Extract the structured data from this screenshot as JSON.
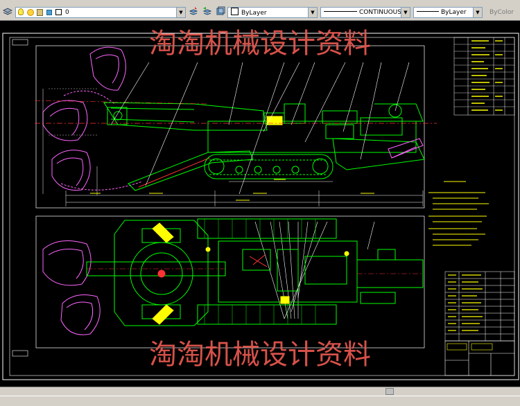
{
  "toolbar": {
    "layer_name": "0",
    "color_value": "ByLayer",
    "linetype_value": "CONTINUOUS",
    "lineweight_value": "ByLayer",
    "plotstyle_value": "ByColor"
  },
  "watermark": {
    "text_top": "淘淘机械设计资料",
    "text_bottom": "淘淘机械设计资料",
    "color": "#e8584f"
  },
  "colors": {
    "frame": "#ffffff",
    "machine": "#00ff00",
    "cutter": "#ff66ff",
    "dimensions": "#ffff00",
    "section": "#ff3333",
    "text": "#ffff00"
  }
}
